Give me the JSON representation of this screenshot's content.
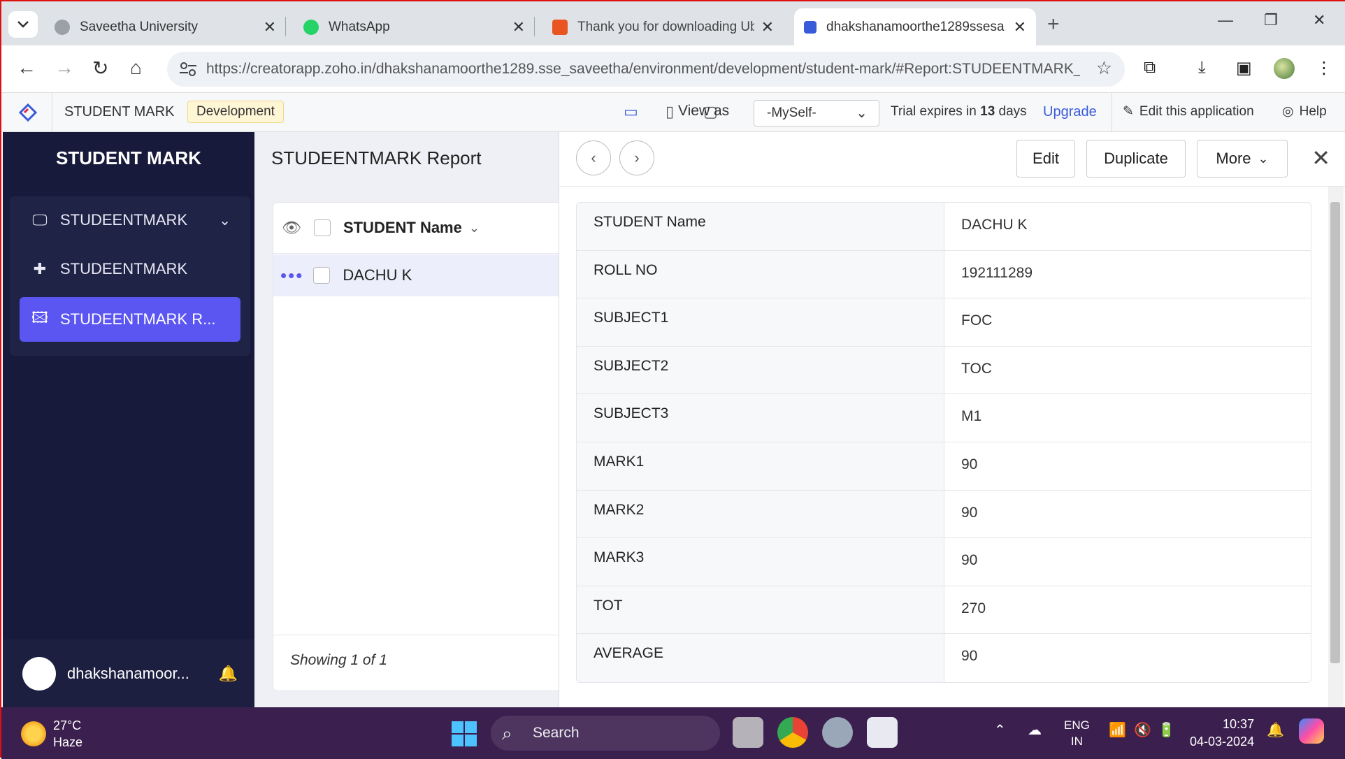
{
  "browser": {
    "tabs": [
      {
        "title": "Saveetha University"
      },
      {
        "title": "WhatsApp"
      },
      {
        "title": "Thank you for downloading Ubu"
      },
      {
        "title": "dhakshanamoorthe1289ssesa"
      }
    ],
    "url": "https://creatorapp.zoho.in/dhakshanamoorthe1289.sse_saveetha/environment/development/student-mark/#Report:STUDEENTMARK_..."
  },
  "appbar": {
    "app_name": "STUDENT MARK",
    "env_badge": "Development",
    "view_as_label": "View as",
    "view_as_value": "-MySelf-",
    "trial_prefix": "Trial expires in",
    "trial_days": "13",
    "trial_suffix": "days",
    "upgrade": "Upgrade",
    "edit_app": "Edit this application",
    "help": "Help"
  },
  "sidebar": {
    "title": "STUDENT MARK",
    "section": "STUDEENTMARK",
    "items": [
      {
        "label": "STUDEENTMARK"
      },
      {
        "label": "STUDEENTMARK R..."
      }
    ],
    "user": "dhakshanamoor..."
  },
  "report": {
    "title": "STUDEENTMARK Report",
    "column_header": "STUDENT Name",
    "rows": [
      {
        "name": "DACHU K"
      }
    ],
    "footer": "Showing 1 of 1"
  },
  "detail": {
    "buttons": {
      "edit": "Edit",
      "duplicate": "Duplicate",
      "more": "More"
    },
    "fields": [
      {
        "label": "STUDENT Name",
        "value": "DACHU K"
      },
      {
        "label": "ROLL NO",
        "value": "192111289"
      },
      {
        "label": "SUBJECT1",
        "value": "FOC"
      },
      {
        "label": "SUBJECT2",
        "value": "TOC"
      },
      {
        "label": "SUBJECT3",
        "value": "M1"
      },
      {
        "label": "MARK1",
        "value": "90"
      },
      {
        "label": "MARK2",
        "value": "90"
      },
      {
        "label": "MARK3",
        "value": "90"
      },
      {
        "label": "TOT",
        "value": "270"
      },
      {
        "label": "AVERAGE",
        "value": "90"
      }
    ]
  },
  "taskbar": {
    "temp": "27°C",
    "weather": "Haze",
    "search": "Search",
    "lang1": "ENG",
    "lang2": "IN",
    "time": "10:37",
    "date": "04-03-2024"
  },
  "colors": {
    "sidebar_bg": "#171a3a",
    "accent": "#5b55f2",
    "link": "#3a5bd9",
    "taskbar": "#3b1f4e"
  }
}
